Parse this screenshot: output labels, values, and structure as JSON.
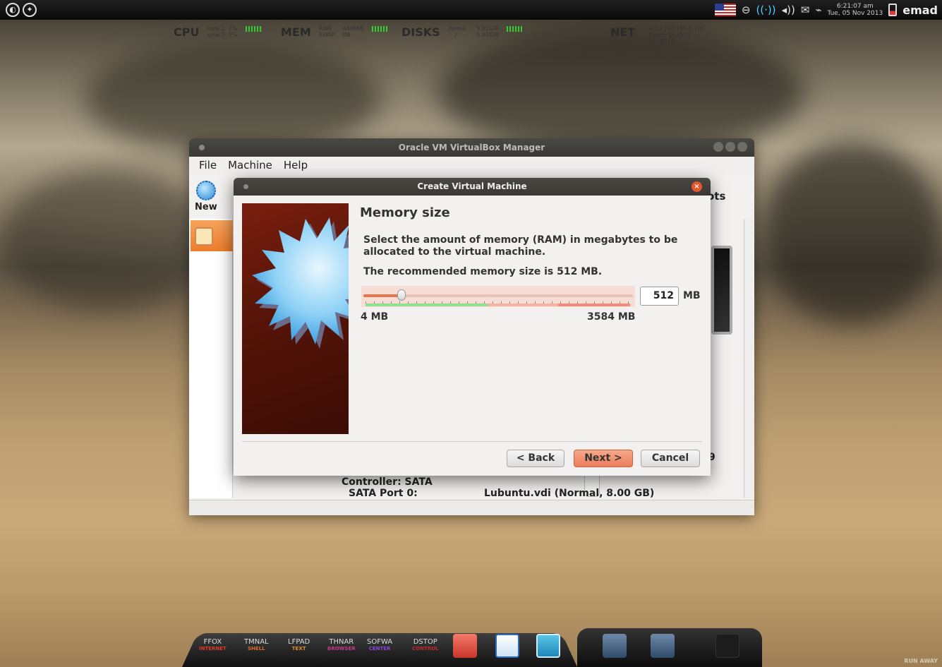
{
  "topbar": {
    "clock_time": "6:21:07 am",
    "clock_date": "Tue, 05 Nov 2013",
    "username": "emad"
  },
  "conky": {
    "cpu_label": "CPU",
    "cpu_core1": "core 1:  7%",
    "cpu_core2": "core 2:  5%",
    "mem_label": "MEM",
    "ram_label": "RAM",
    "ram_value": "440MiB",
    "swap_label": "SWAP",
    "swap_value": "0B",
    "disks_label": "DISKS",
    "disk_home": "/home",
    "disk_root": "/",
    "disk_home_size": "5.81GiB",
    "disk_root_size": "5.81GiB",
    "net_label": "NET",
    "net_iface": "eth0 192.168.0.100",
    "net_down": "Down: 11.6KiB",
    "net_up": "Up: 677B"
  },
  "vbox": {
    "title": "Oracle VM VirtualBox Manager",
    "menu": [
      "File",
      "Machine",
      "Help"
    ],
    "new_label": "New",
    "snapshots_partial": "ots",
    "controller_label": "Controller: SATA",
    "sata_port_label": "SATA Port 0:",
    "sata_port_value": "Lubuntu.vdi (Normal, 8.00 GB)",
    "partial_9": "9"
  },
  "dialog": {
    "title": "Create Virtual Machine",
    "heading": "Memory size",
    "description": "Select the amount of memory (RAM) in megabytes to be allocated to the virtual machine.",
    "recommended": "The recommended memory size is 512 MB.",
    "memory_value": "512",
    "memory_unit": "MB",
    "min_label": "4 MB",
    "max_label": "3584 MB",
    "slider_fraction": 0.142,
    "back_label": "< Back",
    "next_label": "Next >",
    "cancel_label": "Cancel"
  },
  "dock": {
    "launchers": [
      {
        "name": "FFOX",
        "sub": "INTERNET",
        "color": "#e03a2a"
      },
      {
        "name": "TMNAL",
        "sub": "SHELL",
        "color": "#e06a2a"
      },
      {
        "name": "LFPAD",
        "sub": "TEXT",
        "color": "#e0902a"
      },
      {
        "name": "THNAR",
        "sub": "BROWSER",
        "color": "#c63a8a"
      },
      {
        "name": "SOFWA",
        "sub": "CENTER",
        "color": "#8a4ad6"
      },
      {
        "name": "DSTOP",
        "sub": "CONTROL",
        "color": "#c42a2a"
      }
    ]
  },
  "watermark": "RUN AWAY"
}
